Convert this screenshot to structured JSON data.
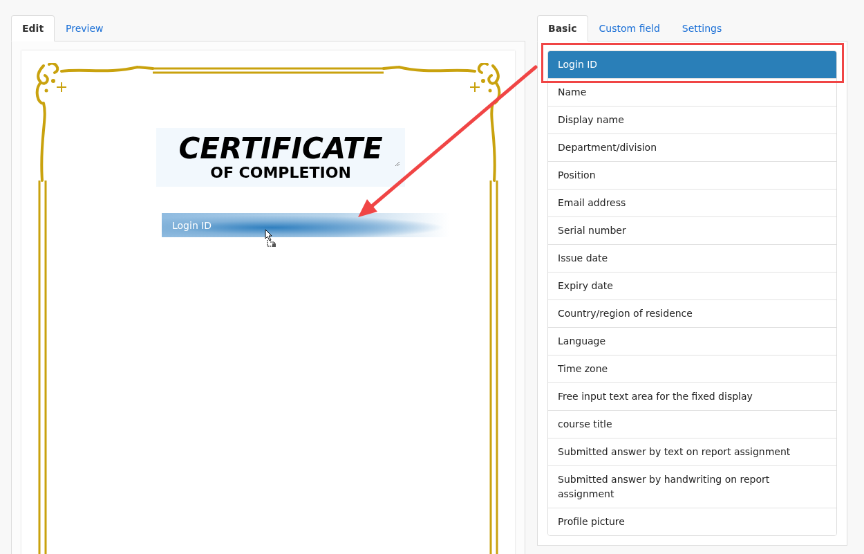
{
  "editor_tabs": [
    {
      "label": "Edit",
      "selected": true
    },
    {
      "label": "Preview",
      "selected": false
    }
  ],
  "certificate": {
    "title": "CERTIFICATE",
    "subtitle": "OF COMPLETION",
    "placed_field": "Login ID"
  },
  "field_tabs": [
    {
      "label": "Basic",
      "selected": true
    },
    {
      "label": "Custom field",
      "selected": false
    },
    {
      "label": "Settings",
      "selected": false
    }
  ],
  "fields": [
    {
      "label": "Login ID",
      "selected": true
    },
    {
      "label": "Name",
      "selected": false
    },
    {
      "label": "Display name",
      "selected": false
    },
    {
      "label": "Department/division",
      "selected": false
    },
    {
      "label": "Position",
      "selected": false
    },
    {
      "label": "Email address",
      "selected": false
    },
    {
      "label": "Serial number",
      "selected": false
    },
    {
      "label": "Issue date",
      "selected": false
    },
    {
      "label": "Expiry date",
      "selected": false
    },
    {
      "label": "Country/region of residence",
      "selected": false
    },
    {
      "label": "Language",
      "selected": false
    },
    {
      "label": "Time zone",
      "selected": false
    },
    {
      "label": "Free input text area for the fixed display",
      "selected": false
    },
    {
      "label": "course title",
      "selected": false
    },
    {
      "label": "Submitted answer by text on report assignment",
      "selected": false
    },
    {
      "label": "Submitted answer by handwriting on report assignment",
      "selected": false
    },
    {
      "label": "Profile picture",
      "selected": false
    }
  ]
}
